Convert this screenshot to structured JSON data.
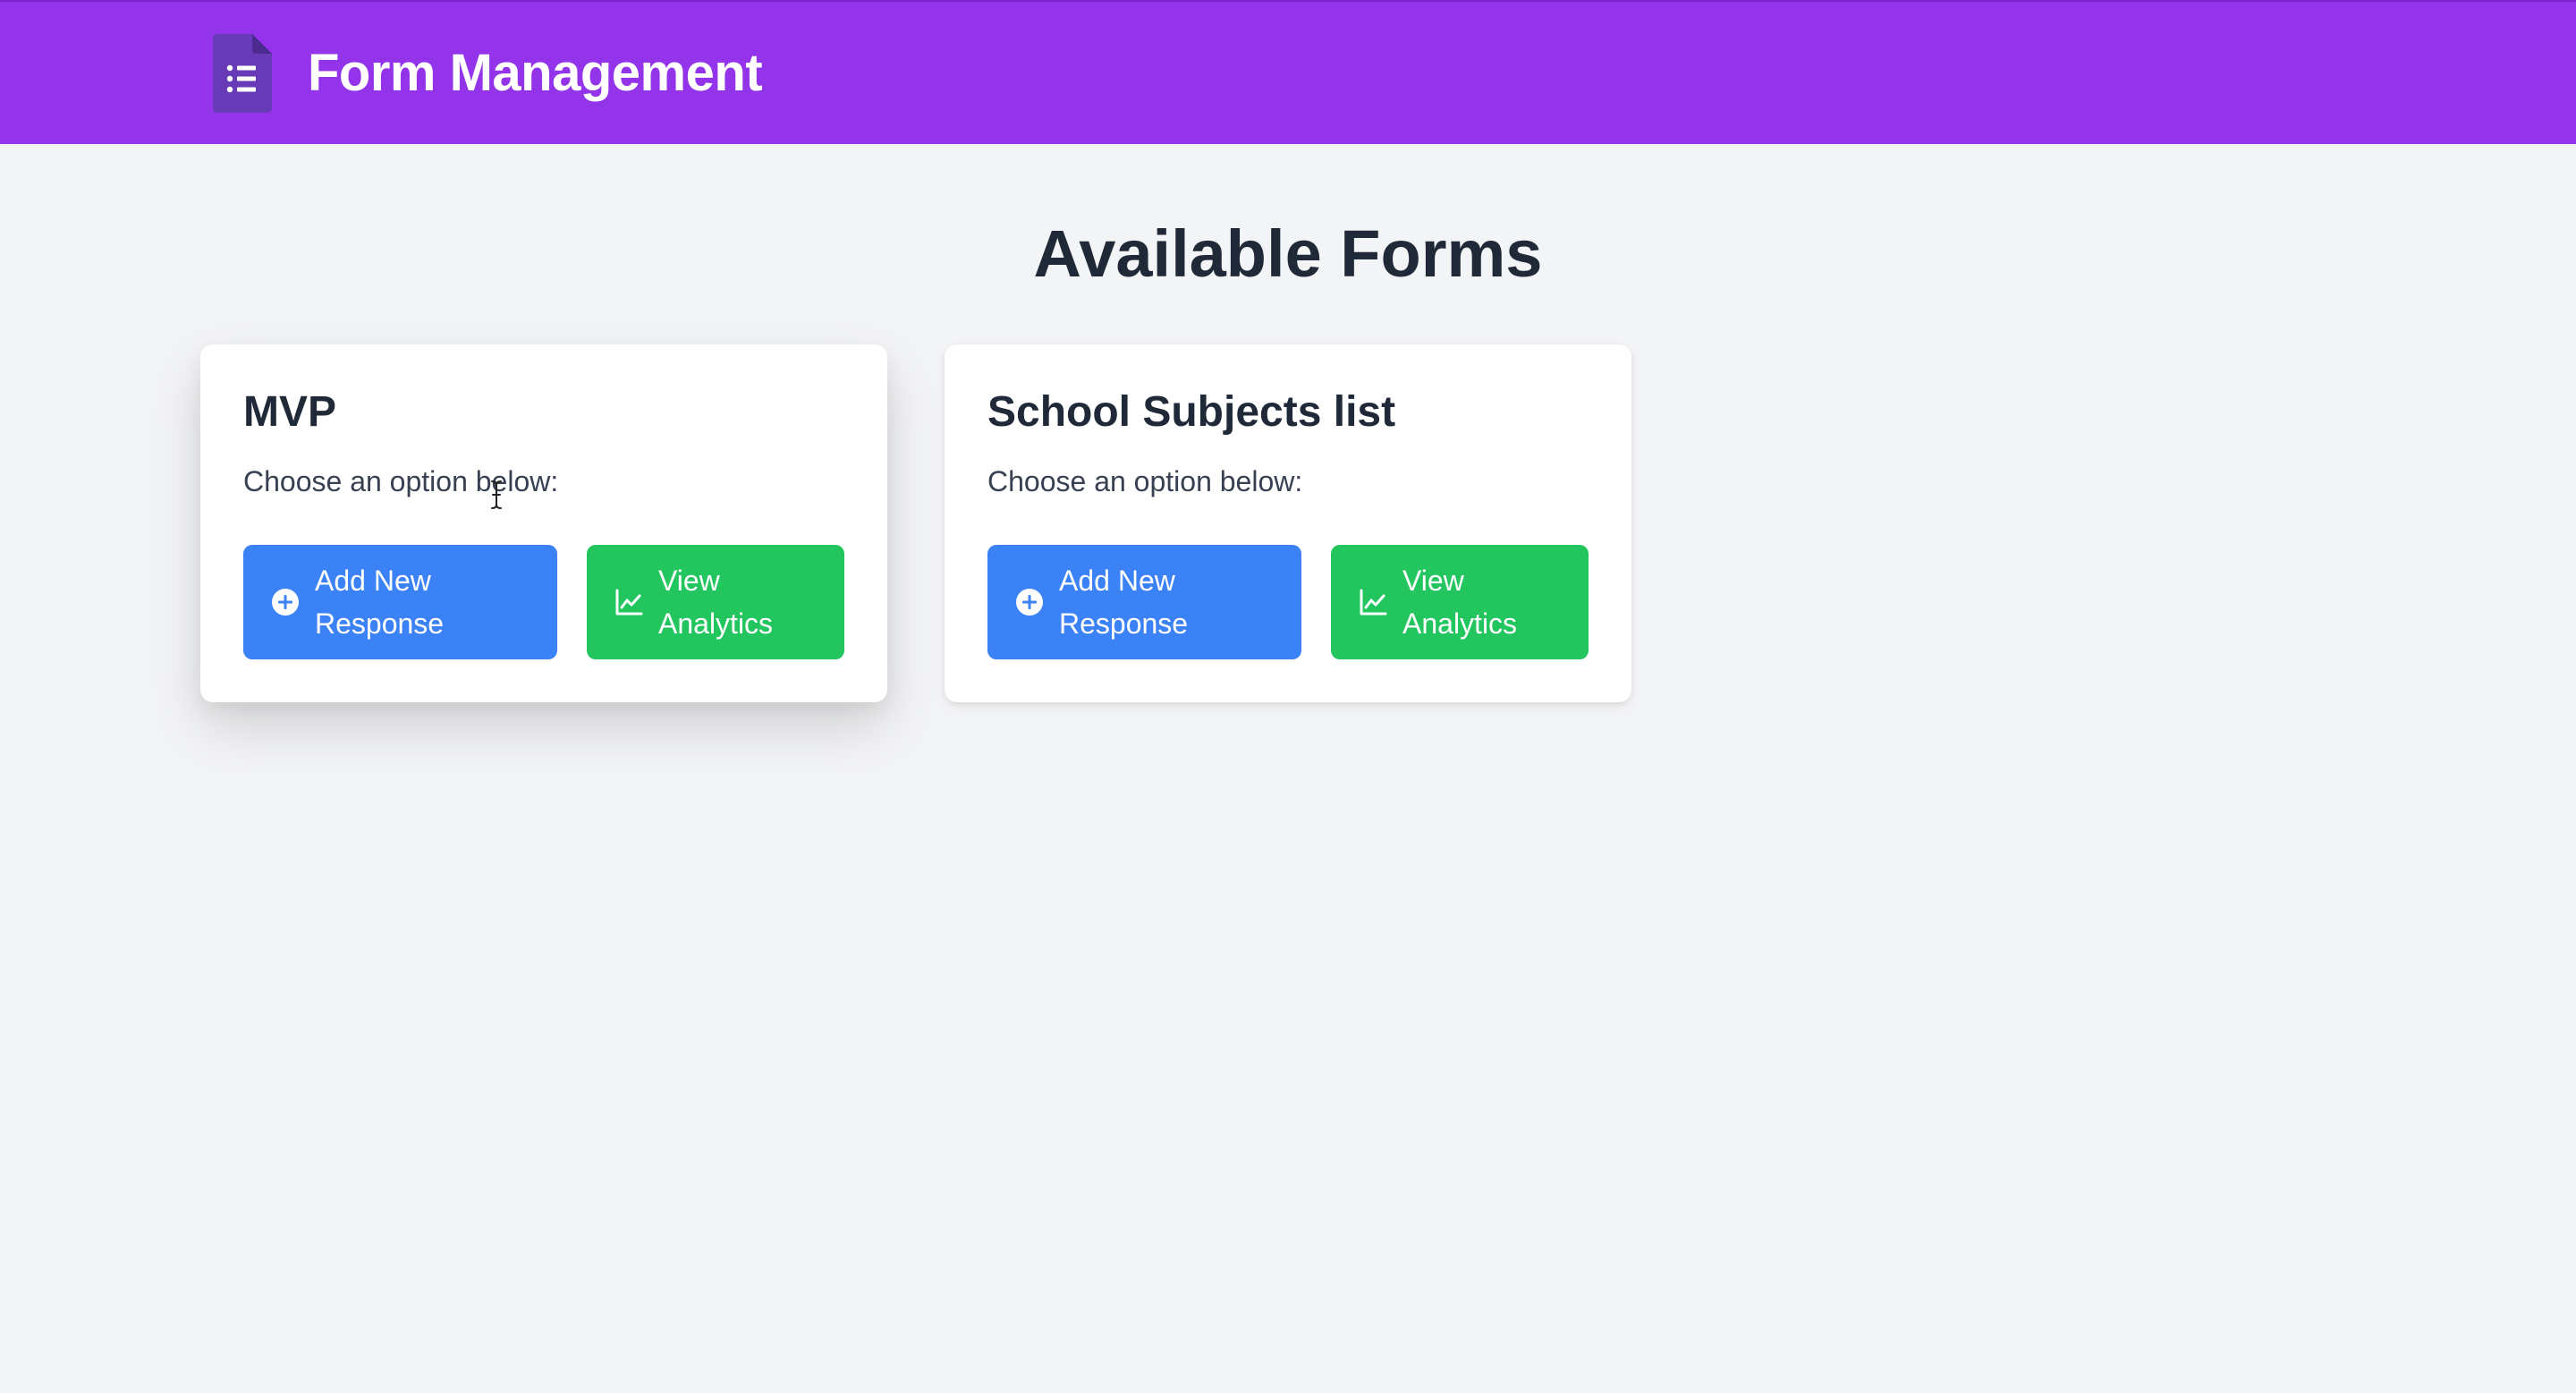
{
  "app": {
    "title": "Form Management",
    "brand_icon": "google-forms-list-icon",
    "header_color": "#9333ea"
  },
  "main": {
    "heading": "Available Forms"
  },
  "forms": [
    {
      "title": "MVP",
      "subtitle": "Choose an option below:",
      "add_label": "Add New Response",
      "add_icon": "plus-circle-icon",
      "view_label": "View Analytics",
      "view_icon": "line-chart-icon"
    },
    {
      "title": "School Subjects list",
      "subtitle": "Choose an option below:",
      "add_label": "Add New Response",
      "add_icon": "plus-circle-icon",
      "view_label": "View Analytics",
      "view_icon": "line-chart-icon"
    }
  ],
  "colors": {
    "add_button": "#3b82f6",
    "view_button": "#22c55e"
  }
}
